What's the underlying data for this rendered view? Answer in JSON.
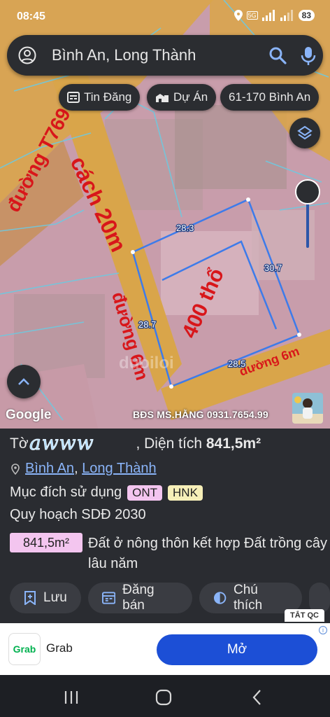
{
  "status": {
    "time": "08:45",
    "network": "5G",
    "battery": "83"
  },
  "search": {
    "query": "Bình An, Long Thành"
  },
  "chips": [
    {
      "label": "Tin Đăng",
      "icon": "newspaper-icon"
    },
    {
      "label": "Dự Án",
      "icon": "buildings-icon"
    },
    {
      "label": "61-170 Bình An"
    }
  ],
  "map": {
    "road_label": "đường T769",
    "distance_label": "cách 20m",
    "lane_label": "đường 6m",
    "bottom_road_label": "đường 6m",
    "residential_label": "400 thổ",
    "dimensions": [
      "28.3",
      "30.7",
      "28.7",
      "28.5"
    ],
    "google_label": "Google",
    "watermark": "BĐS MS.HẰNG 0931.7654.99",
    "brand_watermark": "duoiloi"
  },
  "panel": {
    "title_prefix": "Tờ",
    "title_sticker": "awww",
    "area_label": ", Diện tích",
    "area_value": "841,5m²",
    "location_commune": "Bình An",
    "location_sep": ",",
    "location_district": "Long Thành",
    "purpose_label": "Mục đích sử dụng",
    "purpose_tags": [
      {
        "code": "ONT",
        "color": "#f3c5ef"
      },
      {
        "code": "HNK",
        "color": "#f6efb8"
      }
    ],
    "plan_label": "Quy hoạch SDĐ 2030",
    "plan_area": "841,5m²",
    "plan_purpose": "Đất ở nông thôn kết hợp Đất trồng cây lâu năm",
    "actions": [
      {
        "label": "Lưu",
        "icon": "bookmark-add-icon"
      },
      {
        "label": "Đăng bán",
        "icon": "listing-icon"
      },
      {
        "label": "Chú thích",
        "icon": "legend-icon"
      }
    ]
  },
  "ad": {
    "close_label": "TẮT QC",
    "brand": "Grab",
    "logo_text": "Grab",
    "open_label": "Mở"
  },
  "colors": {
    "accent": "#8ab4f8",
    "road": "#d9a54a",
    "parcel_line": "#3d7bea",
    "label_red": "#d8161a"
  }
}
